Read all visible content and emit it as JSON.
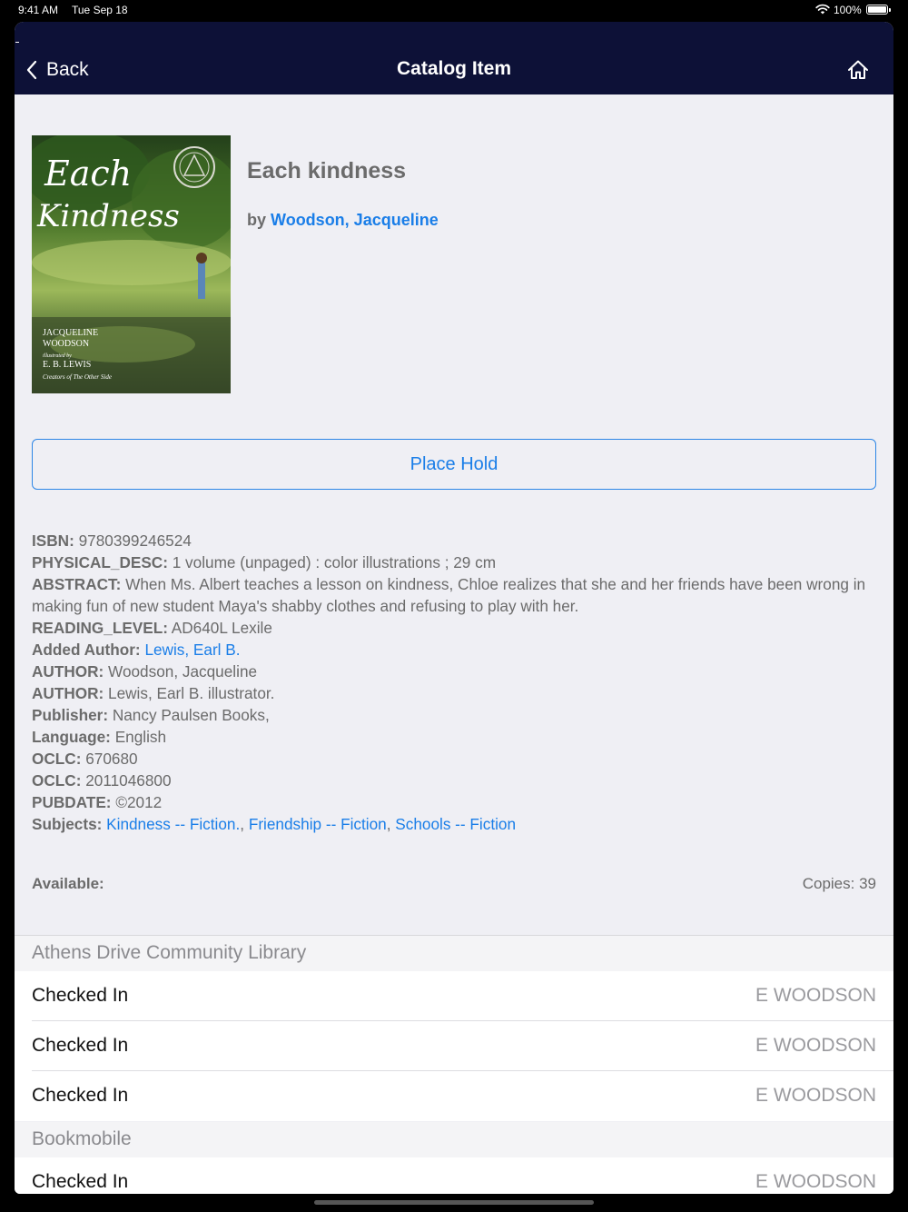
{
  "status_bar": {
    "time": "9:41 AM",
    "date": "Tue Sep 18",
    "battery": "100%",
    "battery_level": 1.0
  },
  "navbar": {
    "back_label": "Back",
    "title": "Catalog Item",
    "home_icon": "home-icon",
    "background": "#0d1137"
  },
  "book": {
    "title": "Each kindness",
    "by_prefix": "by",
    "author_link": "Woodson, Jacqueline",
    "cover": {
      "title_line1": "Each",
      "title_line2": "Kindness",
      "author_line1": "JACQUELINE",
      "author_line2": "WOODSON",
      "illustrated_by": "illustrated by",
      "illustrator": "E. B. LEWIS",
      "tagline": "Creators of The Other Side"
    }
  },
  "actions": {
    "place_hold": "Place Hold"
  },
  "details": {
    "isbn": {
      "label": "ISBN:",
      "value": "9780399246524"
    },
    "physical_desc": {
      "label": "PHYSICAL_DESC:",
      "value": "1 volume (unpaged) : color illustrations ; 29 cm"
    },
    "abstract": {
      "label": "ABSTRACT:",
      "value": "When Ms. Albert teaches a lesson on kindness, Chloe realizes that she and her friends have been wrong in making fun of new student Maya's shabby clothes and refusing to play with her."
    },
    "reading_level": {
      "label": "READING_LEVEL:",
      "value": "AD640L Lexile"
    },
    "added_author": {
      "label": "Added Author:",
      "link": "Lewis, Earl B."
    },
    "author1": {
      "label": "AUTHOR:",
      "value": "Woodson, Jacqueline"
    },
    "author2": {
      "label": "AUTHOR:",
      "value": "Lewis, Earl B. illustrator."
    },
    "publisher": {
      "label": "Publisher:",
      "value": "Nancy Paulsen Books,"
    },
    "language": {
      "label": "Language:",
      "value": "English"
    },
    "oclc1": {
      "label": "OCLC:",
      "value": "670680"
    },
    "oclc2": {
      "label": "OCLC:",
      "value": "2011046800"
    },
    "pubdate": {
      "label": "PUBDATE:",
      "value": "©2012"
    },
    "subjects": {
      "label": "Subjects:",
      "links": [
        "Kindness -- Fiction.",
        "Friendship -- Fiction",
        "Schools -- Fiction"
      ],
      "separator": ", "
    }
  },
  "availability": {
    "label": "Available:",
    "copies": "Copies: 39"
  },
  "locations": [
    {
      "name": "Athens Drive Community Library",
      "items": [
        {
          "status": "Checked In",
          "call_number": "E WOODSON"
        },
        {
          "status": "Checked In",
          "call_number": "E WOODSON"
        },
        {
          "status": "Checked In",
          "call_number": "E WOODSON"
        }
      ]
    },
    {
      "name": "Bookmobile",
      "items": [
        {
          "status": "Checked In",
          "call_number": "E WOODSON"
        }
      ]
    }
  ],
  "colors": {
    "accent": "#1a7ee8",
    "navbar": "#0d1137",
    "page_background": "#efeff4"
  }
}
